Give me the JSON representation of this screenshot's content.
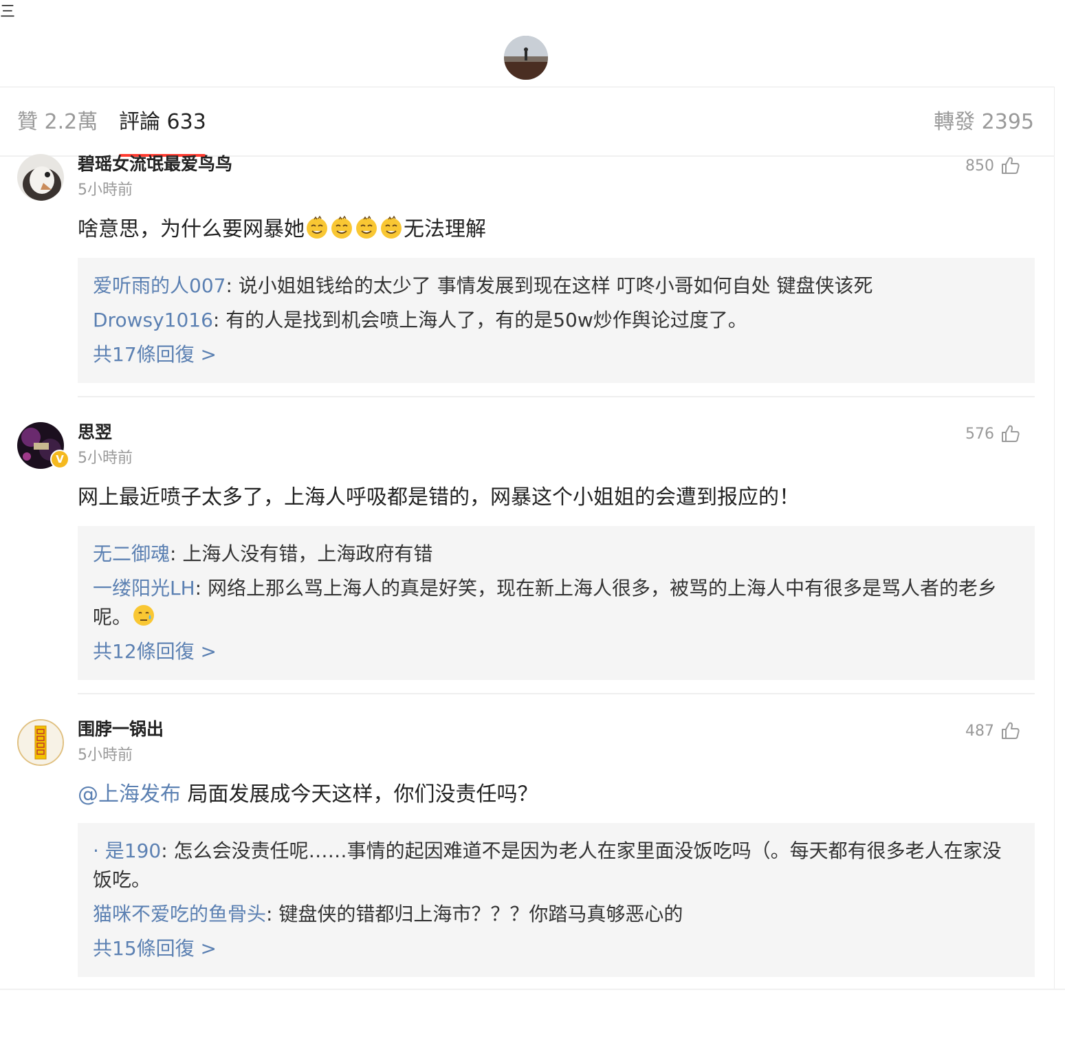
{
  "header": {
    "menu_glyph": "三",
    "profile_avatar_icon": "landscape-avatar-icon"
  },
  "tabs": {
    "likes": "贊 2.2萬",
    "comments": "評論 633",
    "reposts": "轉發 2395"
  },
  "colors": {
    "link": "#5b80b2",
    "accent": "#ff3b30",
    "muted": "#999999",
    "reply_bg": "#f5f5f5",
    "verified": "#f5b91f"
  },
  "comments": [
    {
      "username": "碧瑶女流氓最爱鸟鸟",
      "time": "5小時前",
      "likes": "850",
      "text_before": "啥意思，为什么要网暴她",
      "emoji_count": 4,
      "text_after": "无法理解",
      "replies": [
        {
          "name": "爱听雨的人007",
          "text": ": 说小姐姐钱给的太少了 事情发展到现在这样 叮咚小哥如何自处 键盘侠该死"
        },
        {
          "name": "Drowsy1016",
          "text": ": 有的人是找到机会喷上海人了，有的是50w炒作舆论过度了。"
        }
      ],
      "more": "共17條回復 >"
    },
    {
      "username": "思翌",
      "time": "5小時前",
      "likes": "576",
      "verified": "V",
      "text": "网上最近喷子太多了，上海人呼吸都是错的，网暴这个小姐姐的会遭到报应的！",
      "replies": [
        {
          "name": "无二御魂",
          "text": ": 上海人没有错，上海政府有错"
        },
        {
          "name": "一缕阳光LH",
          "text": ": 网络上那么骂上海人的真是好笑，现在新上海人很多，被骂的上海人中有很多是骂人者的老乡呢。"
        }
      ],
      "more": "共12條回復 >"
    },
    {
      "username": "围脖一锅出",
      "time": "5小時前",
      "likes": "487",
      "mention": "@上海发布",
      "text": " 局面发展成今天这样，你们没责任吗？",
      "replies": [
        {
          "name": "· 是190",
          "text": ": 怎么会没责任呢……事情的起因难道不是因为老人在家里面没饭吃吗（。每天都有很多老人在家没饭吃。"
        },
        {
          "name": "猫咪不爱吃的鱼骨头",
          "text": ": 键盘侠的错都归上海市？？？你踏马真够恶心的"
        }
      ],
      "more": "共15條回復 >"
    }
  ]
}
